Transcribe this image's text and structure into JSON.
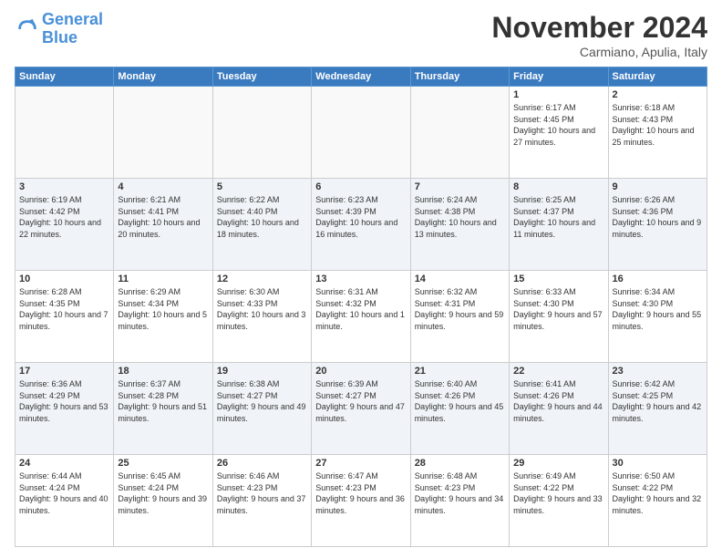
{
  "logo": {
    "line1": "General",
    "line2": "Blue"
  },
  "header": {
    "title": "November 2024",
    "location": "Carmiano, Apulia, Italy"
  },
  "weekdays": [
    "Sunday",
    "Monday",
    "Tuesday",
    "Wednesday",
    "Thursday",
    "Friday",
    "Saturday"
  ],
  "weeks": [
    [
      {
        "day": "",
        "info": ""
      },
      {
        "day": "",
        "info": ""
      },
      {
        "day": "",
        "info": ""
      },
      {
        "day": "",
        "info": ""
      },
      {
        "day": "",
        "info": ""
      },
      {
        "day": "1",
        "info": "Sunrise: 6:17 AM\nSunset: 4:45 PM\nDaylight: 10 hours and 27 minutes."
      },
      {
        "day": "2",
        "info": "Sunrise: 6:18 AM\nSunset: 4:43 PM\nDaylight: 10 hours and 25 minutes."
      }
    ],
    [
      {
        "day": "3",
        "info": "Sunrise: 6:19 AM\nSunset: 4:42 PM\nDaylight: 10 hours and 22 minutes."
      },
      {
        "day": "4",
        "info": "Sunrise: 6:21 AM\nSunset: 4:41 PM\nDaylight: 10 hours and 20 minutes."
      },
      {
        "day": "5",
        "info": "Sunrise: 6:22 AM\nSunset: 4:40 PM\nDaylight: 10 hours and 18 minutes."
      },
      {
        "day": "6",
        "info": "Sunrise: 6:23 AM\nSunset: 4:39 PM\nDaylight: 10 hours and 16 minutes."
      },
      {
        "day": "7",
        "info": "Sunrise: 6:24 AM\nSunset: 4:38 PM\nDaylight: 10 hours and 13 minutes."
      },
      {
        "day": "8",
        "info": "Sunrise: 6:25 AM\nSunset: 4:37 PM\nDaylight: 10 hours and 11 minutes."
      },
      {
        "day": "9",
        "info": "Sunrise: 6:26 AM\nSunset: 4:36 PM\nDaylight: 10 hours and 9 minutes."
      }
    ],
    [
      {
        "day": "10",
        "info": "Sunrise: 6:28 AM\nSunset: 4:35 PM\nDaylight: 10 hours and 7 minutes."
      },
      {
        "day": "11",
        "info": "Sunrise: 6:29 AM\nSunset: 4:34 PM\nDaylight: 10 hours and 5 minutes."
      },
      {
        "day": "12",
        "info": "Sunrise: 6:30 AM\nSunset: 4:33 PM\nDaylight: 10 hours and 3 minutes."
      },
      {
        "day": "13",
        "info": "Sunrise: 6:31 AM\nSunset: 4:32 PM\nDaylight: 10 hours and 1 minute."
      },
      {
        "day": "14",
        "info": "Sunrise: 6:32 AM\nSunset: 4:31 PM\nDaylight: 9 hours and 59 minutes."
      },
      {
        "day": "15",
        "info": "Sunrise: 6:33 AM\nSunset: 4:30 PM\nDaylight: 9 hours and 57 minutes."
      },
      {
        "day": "16",
        "info": "Sunrise: 6:34 AM\nSunset: 4:30 PM\nDaylight: 9 hours and 55 minutes."
      }
    ],
    [
      {
        "day": "17",
        "info": "Sunrise: 6:36 AM\nSunset: 4:29 PM\nDaylight: 9 hours and 53 minutes."
      },
      {
        "day": "18",
        "info": "Sunrise: 6:37 AM\nSunset: 4:28 PM\nDaylight: 9 hours and 51 minutes."
      },
      {
        "day": "19",
        "info": "Sunrise: 6:38 AM\nSunset: 4:27 PM\nDaylight: 9 hours and 49 minutes."
      },
      {
        "day": "20",
        "info": "Sunrise: 6:39 AM\nSunset: 4:27 PM\nDaylight: 9 hours and 47 minutes."
      },
      {
        "day": "21",
        "info": "Sunrise: 6:40 AM\nSunset: 4:26 PM\nDaylight: 9 hours and 45 minutes."
      },
      {
        "day": "22",
        "info": "Sunrise: 6:41 AM\nSunset: 4:26 PM\nDaylight: 9 hours and 44 minutes."
      },
      {
        "day": "23",
        "info": "Sunrise: 6:42 AM\nSunset: 4:25 PM\nDaylight: 9 hours and 42 minutes."
      }
    ],
    [
      {
        "day": "24",
        "info": "Sunrise: 6:44 AM\nSunset: 4:24 PM\nDaylight: 9 hours and 40 minutes."
      },
      {
        "day": "25",
        "info": "Sunrise: 6:45 AM\nSunset: 4:24 PM\nDaylight: 9 hours and 39 minutes."
      },
      {
        "day": "26",
        "info": "Sunrise: 6:46 AM\nSunset: 4:23 PM\nDaylight: 9 hours and 37 minutes."
      },
      {
        "day": "27",
        "info": "Sunrise: 6:47 AM\nSunset: 4:23 PM\nDaylight: 9 hours and 36 minutes."
      },
      {
        "day": "28",
        "info": "Sunrise: 6:48 AM\nSunset: 4:23 PM\nDaylight: 9 hours and 34 minutes."
      },
      {
        "day": "29",
        "info": "Sunrise: 6:49 AM\nSunset: 4:22 PM\nDaylight: 9 hours and 33 minutes."
      },
      {
        "day": "30",
        "info": "Sunrise: 6:50 AM\nSunset: 4:22 PM\nDaylight: 9 hours and 32 minutes."
      }
    ]
  ]
}
